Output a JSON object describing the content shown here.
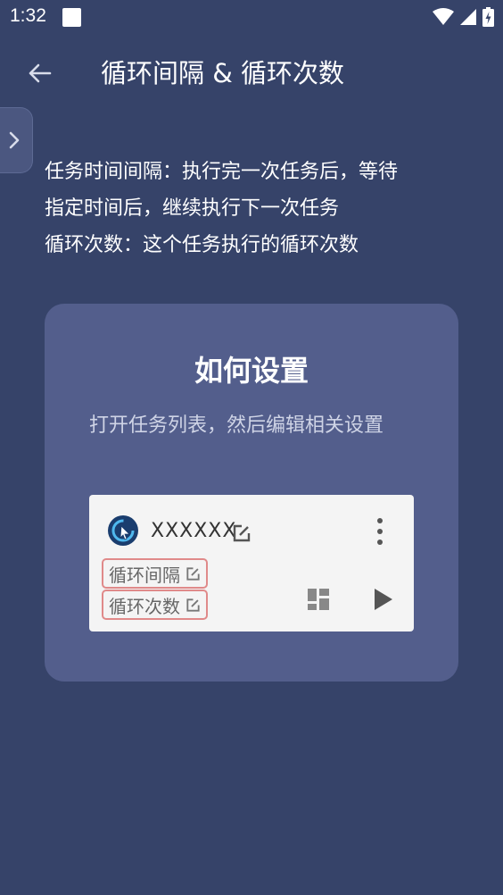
{
  "status_bar": {
    "time": "1:32",
    "icons": [
      "notification-square-icon",
      "wifi-icon",
      "cell-signal-icon",
      "battery-charging-icon"
    ]
  },
  "app_bar": {
    "title": "循环间隔 & 循环次数",
    "back_icon": "arrow-left-icon"
  },
  "side_tab": {
    "icon": "chevron-right-icon"
  },
  "description": {
    "lines": [
      "任务时间间隔：执行完一次任务后，等待",
      "指定时间后，继续执行下一次任务",
      "循环次数：这个任务执行的循环次数"
    ]
  },
  "how_to_card": {
    "title": "如何设置",
    "text": "打开任务列表，然后编辑相关设置",
    "preview": {
      "task_name": "XXXXXX",
      "interval_label": "循环间隔",
      "count_label": "循环次数",
      "highlight_color": "#e08a8a"
    }
  },
  "colors": {
    "background": "#364369",
    "card": "#535e8c",
    "preview_bg": "#f4f4f4",
    "task_icon": "#1a3d6e"
  }
}
